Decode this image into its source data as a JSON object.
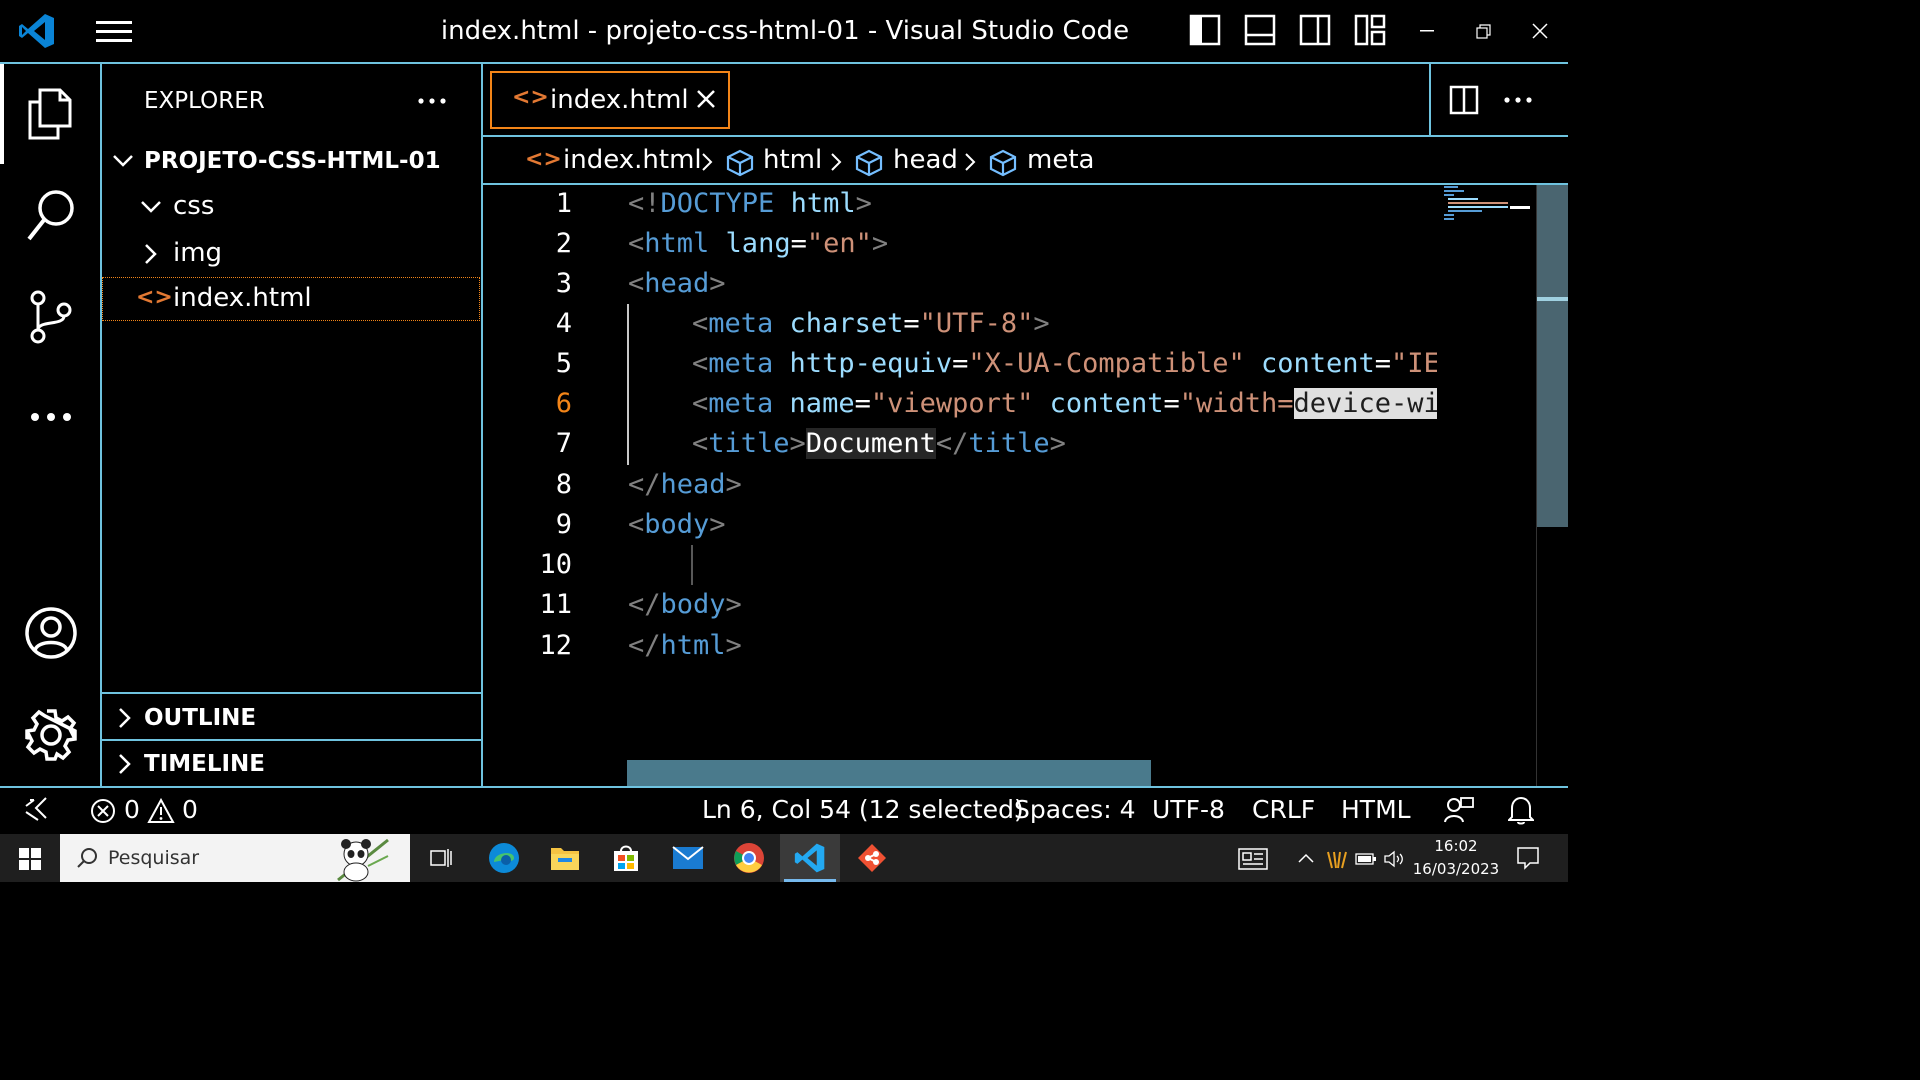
{
  "window": {
    "title": "index.html - projeto-css-html-01 - Visual Studio Code"
  },
  "sidebar": {
    "title": "EXPLORER",
    "more": "···",
    "folder": "PROJETO-CSS-HTML-01",
    "items": [
      {
        "label": "css",
        "type": "folder-open"
      },
      {
        "label": "img",
        "type": "folder-closed"
      },
      {
        "label": "index.html",
        "type": "file",
        "icon": "<>"
      }
    ],
    "outline": "OUTLINE",
    "timeline": "TIMELINE"
  },
  "tab": {
    "icon": "<>",
    "label": "index.html",
    "close": "✕"
  },
  "breadcrumb": {
    "file_icon": "<>",
    "file": "index.html",
    "items": [
      "html",
      "head",
      "meta"
    ]
  },
  "editor": {
    "line_numbers": [
      "1",
      "2",
      "3",
      "4",
      "5",
      "6",
      "7",
      "8",
      "9",
      "10",
      "11",
      "12"
    ],
    "active_line": "6",
    "lines": {
      "l1": {
        "p1": "<!",
        "t1": "DOCTYPE",
        "a1": " html",
        "p2": ">"
      },
      "l2": {
        "p1": "<",
        "t1": "html",
        "a1": " lang",
        "p2": "=",
        "s1": "\"en\"",
        "p3": ">"
      },
      "l3": {
        "p1": "<",
        "t1": "head",
        "p2": ">"
      },
      "l4": {
        "p1": "<",
        "t1": "meta",
        "a1": " charset",
        "p2": "=",
        "s1": "\"UTF-8\"",
        "p3": ">"
      },
      "l5": {
        "p1": "<",
        "t1": "meta",
        "a1": " http-equiv",
        "p2": "=",
        "s1": "\"X-UA-Compatible\"",
        "a2": " content",
        "p3": "=",
        "s2": "\"IE"
      },
      "l6": {
        "p1": "<",
        "t1": "meta",
        "a1": " name",
        "p2": "=",
        "s1": "\"viewport\"",
        "a2": " content",
        "p3": "=",
        "s2": "\"width=",
        "sel": "device-wi"
      },
      "l7": {
        "p1": "<",
        "t1": "title",
        "p2": ">",
        "txt": "Document",
        "p3": "</",
        "t2": "title",
        "p4": ">"
      },
      "l8": {
        "p1": "</",
        "t1": "head",
        "p2": ">"
      },
      "l9": {
        "p1": "<",
        "t1": "body",
        "p2": ">"
      },
      "l11": {
        "p1": "</",
        "t1": "body",
        "p2": ">"
      },
      "l12": {
        "p1": "</",
        "t1": "html",
        "p2": ">"
      }
    }
  },
  "statusbar": {
    "errors": "0",
    "warnings": "0",
    "position": "Ln 6, Col 54 (12 selected)",
    "spaces": "Spaces: 4",
    "encoding": "UTF-8",
    "eol": "CRLF",
    "language": "HTML"
  },
  "taskbar": {
    "search_placeholder": "Pesquisar",
    "time": "16:02",
    "date": "16/03/2023"
  },
  "colors": {
    "accent_border": "#6fc3df",
    "tab_border": "#f38518",
    "tag": "#569cd6",
    "attr": "#9cdcfe",
    "string": "#ce9178",
    "vscode_blue": "#0078d4"
  }
}
